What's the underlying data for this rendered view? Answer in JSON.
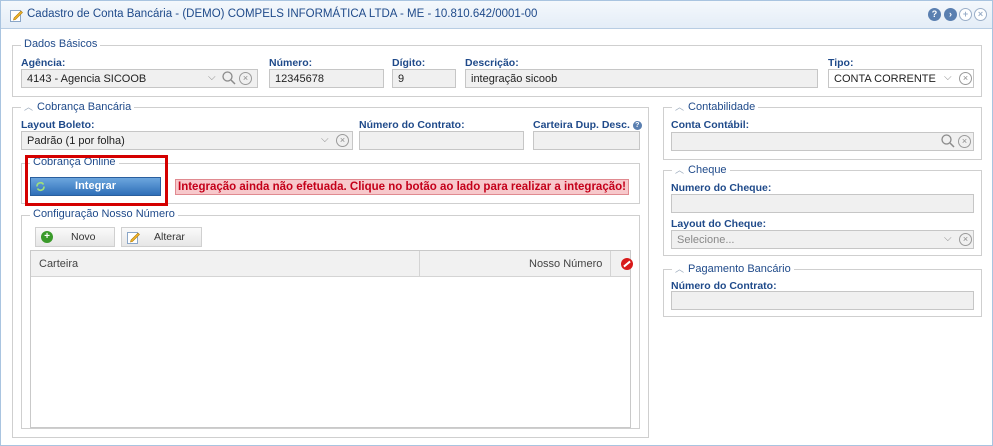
{
  "window": {
    "title": "Cadastro de Conta Bancária - (DEMO) COMPELS INFORMÁTICA LTDA - ME - 10.810.642/0001-00",
    "title_icon": "pencil-edit-icon",
    "buttons": [
      "help-icon",
      "next-icon",
      "maximize-icon",
      "close-icon"
    ]
  },
  "dados_basicos": {
    "legend": "Dados Básicos",
    "agencia": {
      "label": "Agência:",
      "value": "4143 - Agencia SICOOB"
    },
    "numero": {
      "label": "Número:",
      "value": "12345678"
    },
    "digito": {
      "label": "Dígito:",
      "value": "9"
    },
    "descricao": {
      "label": "Descrição:",
      "value": "integração sicoob"
    },
    "tipo": {
      "label": "Tipo:",
      "value": "CONTA CORRENTE"
    }
  },
  "cobranca": {
    "legend": "Cobrança Bancária",
    "layout_boleto": {
      "label": "Layout Boleto:",
      "value": "Padrão (1 por folha)"
    },
    "numero_contrato": {
      "label": "Número do Contrato:",
      "value": ""
    },
    "carteira_dup": {
      "label": "Carteira Dup. Desc.",
      "value": ""
    },
    "online": {
      "legend": "Cobrança Online",
      "integrar_label": "Integrar",
      "warning": "Integração ainda não efetuada. Clique no botão ao lado para realizar a integração!"
    },
    "nosso_numero": {
      "legend": "Configuração Nosso Número",
      "novo_label": "Novo",
      "alterar_label": "Alterar",
      "columns": [
        "Carteira",
        "Nosso Número"
      ],
      "rows": []
    }
  },
  "contabilidade": {
    "legend": "Contabilidade",
    "conta_contabil": {
      "label": "Conta Contábil:",
      "value": ""
    }
  },
  "cheque": {
    "legend": "Cheque",
    "numero_cheque": {
      "label": "Numero do Cheque:",
      "value": ""
    },
    "layout_cheque": {
      "label": "Layout do Cheque:",
      "placeholder": "Selecione..."
    }
  },
  "pagamento": {
    "legend": "Pagamento Bancário",
    "numero_contrato": {
      "label": "Número do Contrato:",
      "value": ""
    }
  },
  "colors": {
    "accent": "#1f4a8a",
    "highlight": "#d40000",
    "warning_bg": "#f7c8cb"
  }
}
